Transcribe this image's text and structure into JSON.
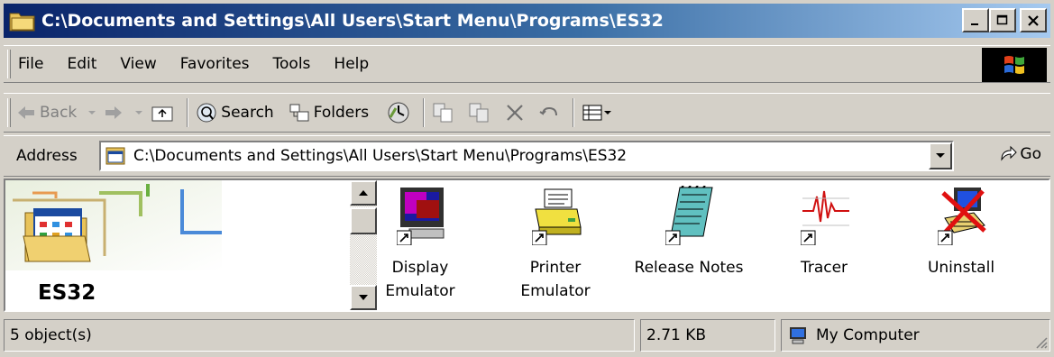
{
  "window": {
    "title": "C:\\Documents and Settings\\All Users\\Start Menu\\Programs\\ES32",
    "controls": {
      "minimize": "_",
      "maximize": "□",
      "close": "×"
    }
  },
  "menubar": {
    "items": [
      "File",
      "Edit",
      "View",
      "Favorites",
      "Tools",
      "Help"
    ]
  },
  "toolbar": {
    "back": "Back",
    "search": "Search",
    "folders": "Folders"
  },
  "address": {
    "label": "Address",
    "value": "C:\\Documents and Settings\\All Users\\Start Menu\\Programs\\ES32",
    "go": "Go"
  },
  "folder": {
    "name": "ES32"
  },
  "items": [
    {
      "label": "Display\nEmulator",
      "icon": "monitor-icon"
    },
    {
      "label": "Printer\nEmulator",
      "icon": "printer-icon"
    },
    {
      "label": "Release Notes",
      "icon": "notepad-icon"
    },
    {
      "label": "Tracer",
      "icon": "waveform-icon"
    },
    {
      "label": "Uninstall",
      "icon": "uninstall-icon"
    }
  ],
  "status": {
    "objects": "5 object(s)",
    "size": "2.71 KB",
    "location": "My Computer"
  },
  "colors": {
    "title_start": "#0a246a",
    "title_end": "#a6caf0",
    "face": "#d4d0c8"
  }
}
